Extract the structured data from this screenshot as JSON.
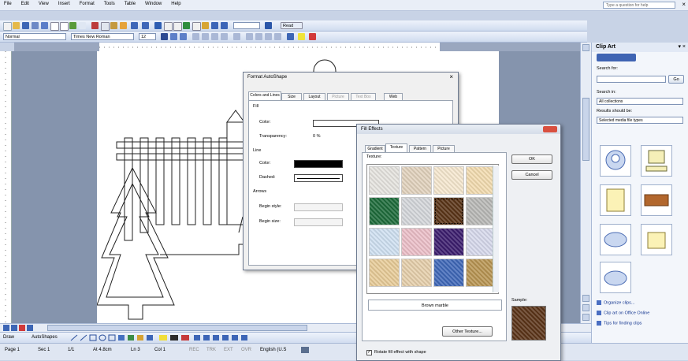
{
  "menu": [
    "File",
    "Edit",
    "View",
    "Insert",
    "Format",
    "Tools",
    "Table",
    "Window",
    "Help"
  ],
  "help_placeholder": "Type a question for help",
  "formatting": {
    "style": "Normal",
    "font": "Times New Roman",
    "size": "12",
    "reading_label": "Read"
  },
  "clipart": {
    "title": "Clip Art",
    "search_for_label": "Search for:",
    "go_label": "Go",
    "search_in_label": "Search in:",
    "search_in_value": "All collections",
    "results_label": "Results should be:",
    "results_value": "Selected media file types",
    "links": [
      "Organize clips...",
      "Clip art on Office Online",
      "Tips for finding clips"
    ]
  },
  "format_dialog": {
    "title": "Format AutoShape",
    "tabs": [
      "Colors and Lines",
      "Size",
      "Layout",
      "Picture",
      "Text Box",
      "Web"
    ],
    "fill_label": "Fill",
    "color_label": "Color:",
    "transparency_label": "Transparency:",
    "transparency_value": "0 %",
    "line_label": "Line",
    "line_color_label": "Color:",
    "dashed_label": "Dashed:",
    "arrows_label": "Arrows",
    "begin_style_label": "Begin style:",
    "begin_size_label": "Begin size:"
  },
  "fill_effects": {
    "title": "Fill Effects",
    "tabs": [
      "Gradient",
      "Texture",
      "Pattern",
      "Picture"
    ],
    "texture_label": "Texture:",
    "ok_label": "OK",
    "cancel_label": "Cancel",
    "selected_name": "Brown marble",
    "other_texture_label": "Other Texture...",
    "sample_label": "Sample:",
    "rotate_label": "Rotate fill effect with shape",
    "colors": {
      "textures": [
        "#e6e4df",
        "#e2d2bd",
        "#f6e8cf",
        "#f3dcb0",
        "#1d6b3a",
        "#d4d7db",
        "#5a3417",
        "#b8b8b6",
        "#cfe1f2",
        "#ecbfc8",
        "#3c1d6e",
        "#d7d9ec",
        "#e8cc98",
        "#e6cfab",
        "#3f68b8",
        "#b89552"
      ],
      "sample": "#5b3418"
    }
  },
  "status": [
    "Page 1",
    "Sec 1",
    "1/1",
    "At 4.8cm",
    "Ln 3",
    "Col 1",
    "REC",
    "TRK",
    "EXT",
    "OVR",
    "English (U.S"
  ],
  "draw_label": "Draw",
  "autoshapes_label": "AutoShapes"
}
